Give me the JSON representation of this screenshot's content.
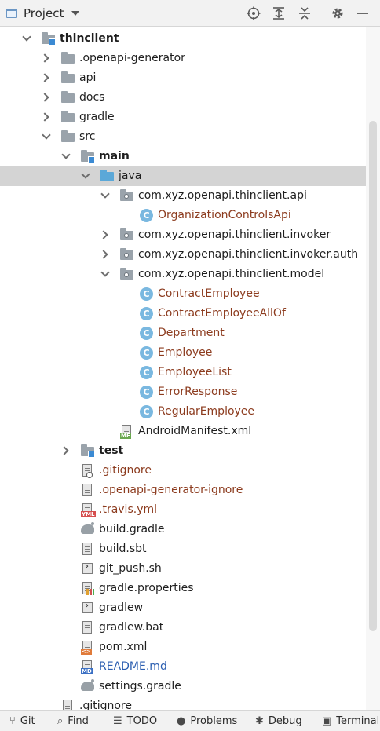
{
  "header": {
    "title": "Project",
    "toolbar": [
      "target-icon",
      "expand-all-icon",
      "collapse-all-icon",
      "gear-icon",
      "minimize-icon"
    ]
  },
  "tree": {
    "rows": [
      {
        "label": "thinclient",
        "depth": 0,
        "expanded": true,
        "icon": "module-folder-icon",
        "style": "bold"
      },
      {
        "label": ".openapi-generator",
        "depth": 1,
        "expanded": false,
        "icon": "folder-icon"
      },
      {
        "label": "api",
        "depth": 1,
        "expanded": false,
        "icon": "folder-icon"
      },
      {
        "label": "docs",
        "depth": 1,
        "expanded": false,
        "icon": "folder-icon"
      },
      {
        "label": "gradle",
        "depth": 1,
        "expanded": false,
        "icon": "folder-icon"
      },
      {
        "label": "src",
        "depth": 1,
        "expanded": true,
        "icon": "folder-icon"
      },
      {
        "label": "main",
        "depth": 2,
        "expanded": true,
        "icon": "module-folder-icon",
        "style": "bold"
      },
      {
        "label": "java",
        "depth": 3,
        "expanded": true,
        "icon": "java-source-folder-icon",
        "selected": true
      },
      {
        "label": "com.xyz.openapi.thinclient.api",
        "depth": 4,
        "expanded": true,
        "icon": "package-icon"
      },
      {
        "label": "OrganizationControlsApi",
        "depth": 5,
        "icon": "class-icon",
        "style": "modified"
      },
      {
        "label": "com.xyz.openapi.thinclient.invoker",
        "depth": 4,
        "expanded": false,
        "icon": "package-icon"
      },
      {
        "label": "com.xyz.openapi.thinclient.invoker.auth",
        "depth": 4,
        "expanded": false,
        "icon": "package-icon"
      },
      {
        "label": "com.xyz.openapi.thinclient.model",
        "depth": 4,
        "expanded": true,
        "icon": "package-icon"
      },
      {
        "label": "ContractEmployee",
        "depth": 5,
        "icon": "class-icon",
        "style": "modified"
      },
      {
        "label": "ContractEmployeeAllOf",
        "depth": 5,
        "icon": "class-icon",
        "style": "modified"
      },
      {
        "label": "Department",
        "depth": 5,
        "icon": "class-icon",
        "style": "modified"
      },
      {
        "label": "Employee",
        "depth": 5,
        "icon": "class-icon",
        "style": "modified"
      },
      {
        "label": "EmployeeList",
        "depth": 5,
        "icon": "class-icon",
        "style": "modified"
      },
      {
        "label": "ErrorResponse",
        "depth": 5,
        "icon": "class-icon",
        "style": "modified"
      },
      {
        "label": "RegularEmployee",
        "depth": 5,
        "icon": "class-icon",
        "style": "modified"
      },
      {
        "label": "AndroidManifest.xml",
        "depth": 4,
        "icon": "manifest-file-icon"
      },
      {
        "label": "test",
        "depth": 2,
        "expanded": false,
        "icon": "module-folder-icon",
        "style": "bold"
      },
      {
        "label": ".gitignore",
        "depth": 2,
        "icon": "ignore-file-icon",
        "style": "modified"
      },
      {
        "label": ".openapi-generator-ignore",
        "depth": 2,
        "icon": "text-file-icon",
        "style": "modified"
      },
      {
        "label": ".travis.yml",
        "depth": 2,
        "icon": "yml-file-icon",
        "style": "modified"
      },
      {
        "label": "build.gradle",
        "depth": 2,
        "icon": "gradle-icon"
      },
      {
        "label": "build.sbt",
        "depth": 2,
        "icon": "text-file-icon"
      },
      {
        "label": "git_push.sh",
        "depth": 2,
        "icon": "shell-script-icon"
      },
      {
        "label": "gradle.properties",
        "depth": 2,
        "icon": "properties-file-icon"
      },
      {
        "label": "gradlew",
        "depth": 2,
        "icon": "shell-script-icon"
      },
      {
        "label": "gradlew.bat",
        "depth": 2,
        "icon": "text-file-icon"
      },
      {
        "label": "pom.xml",
        "depth": 2,
        "icon": "xml-file-icon"
      },
      {
        "label": "README.md",
        "depth": 2,
        "icon": "markdown-file-icon",
        "style": "blue"
      },
      {
        "label": "settings.gradle",
        "depth": 2,
        "icon": "gradle-icon"
      },
      {
        "label": ".gitignore",
        "depth": 1,
        "icon": "text-file-icon"
      }
    ]
  },
  "icon_tags": {
    "yml": "YML",
    "md": "MD",
    "mf": "MF",
    "xml": "<>",
    "class": "C"
  },
  "bottom_bar": [
    {
      "label": "Git",
      "icon": "git-branch-icon"
    },
    {
      "label": "Find",
      "icon": "search-icon"
    },
    {
      "label": "TODO",
      "icon": "todo-list-icon"
    },
    {
      "label": "Problems",
      "icon": "problems-icon"
    },
    {
      "label": "Debug",
      "icon": "bug-icon"
    },
    {
      "label": "Terminal",
      "icon": "terminal-icon"
    }
  ],
  "colors": {
    "modified_text": "#8c3b1e",
    "readme_text": "#2a5db0",
    "selection_bg": "#d4d4d4",
    "class_icon": "#7ab8e0",
    "java_folder": "#5ba8d8"
  }
}
